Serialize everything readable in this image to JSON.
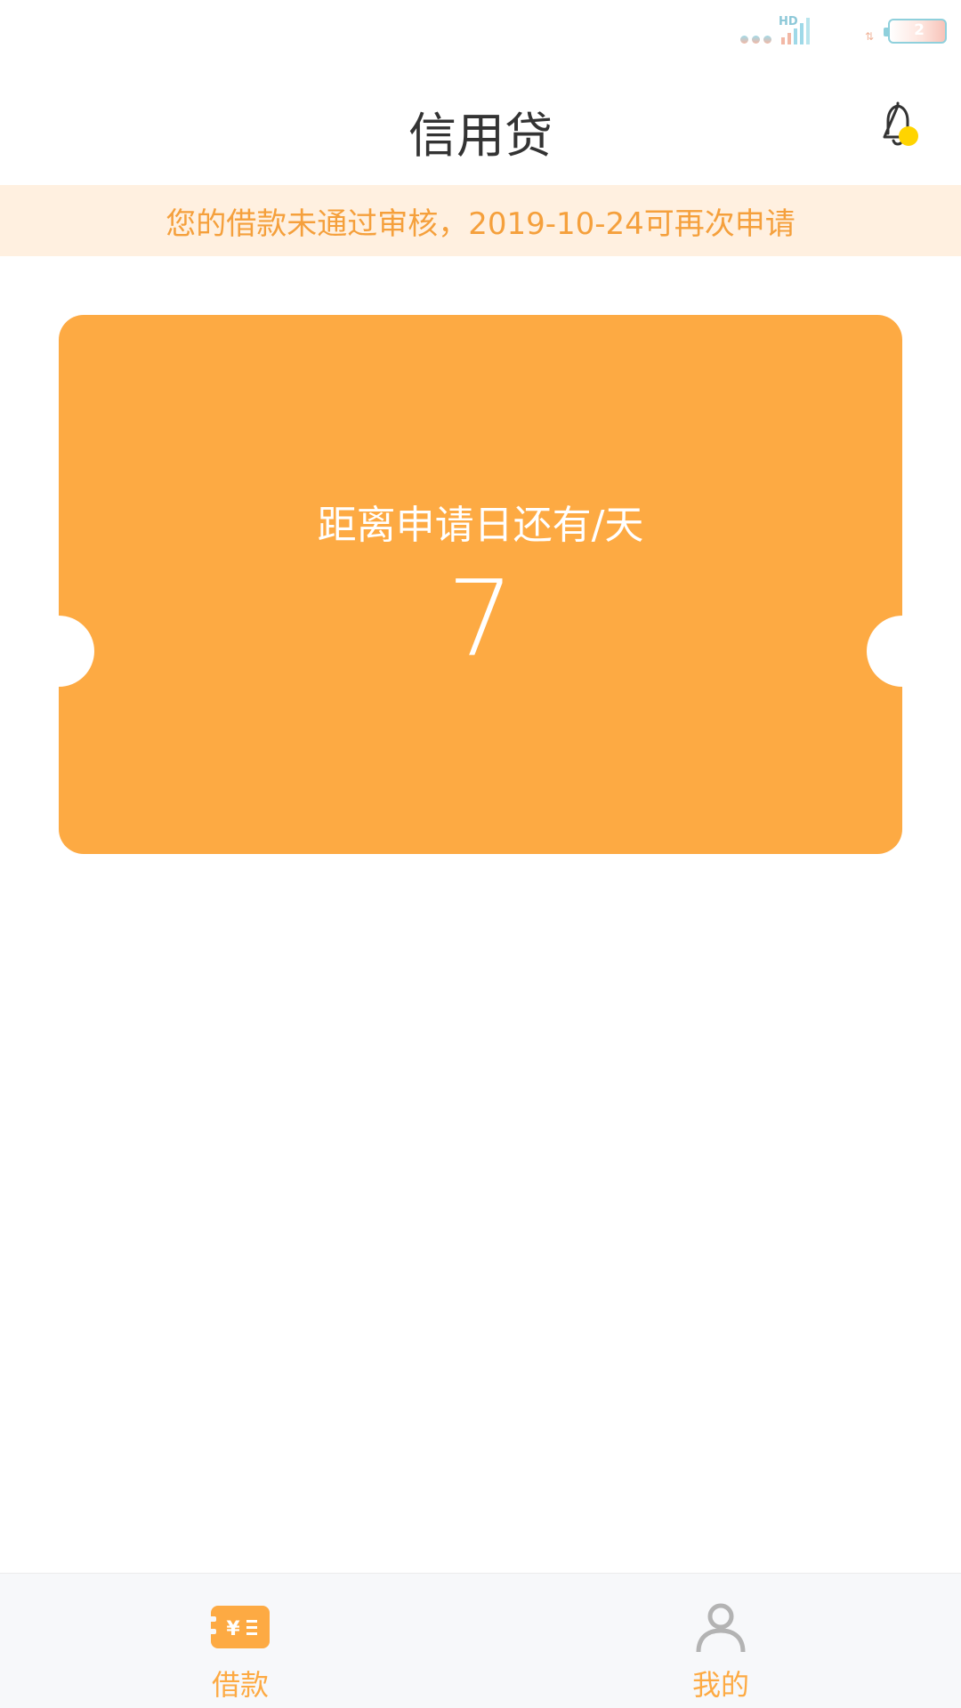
{
  "status_bar": {
    "network_label": "HD",
    "battery_level": "2"
  },
  "header": {
    "title": "信用贷"
  },
  "notice": {
    "text": "您的借款未通过审核，2019-10-24可再次申请"
  },
  "ticket": {
    "label": "距离申请日还有/天",
    "days": "7"
  },
  "bottom_nav": {
    "items": [
      {
        "label": "借款",
        "icon": "loan-icon",
        "active": true
      },
      {
        "label": "我的",
        "icon": "user-icon",
        "active": false
      }
    ]
  },
  "colors": {
    "accent": "#fdaa43",
    "notice_bg": "#fff0e0",
    "notice_text": "#f5a03c",
    "bell_dot": "#ffd400",
    "title_text": "#333333"
  }
}
